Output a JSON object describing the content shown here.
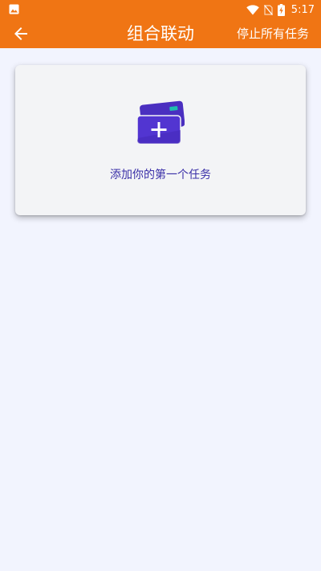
{
  "status_bar": {
    "time": "5:17",
    "icons": [
      "image-icon",
      "wifi-icon",
      "no-sim-icon",
      "battery-charging-icon"
    ]
  },
  "app_bar": {
    "title": "组合联动",
    "back_icon": "arrow-left-icon",
    "action_label": "停止所有任务"
  },
  "empty_state": {
    "icon": "add-task-cards-icon",
    "message": "添加你的第一个任务"
  },
  "colors": {
    "header": "#f07514",
    "background": "#f2f4fe",
    "card": "#f3f4f6",
    "accent": "#3a2fa8",
    "icon_purple": "#4a2fc0",
    "icon_teal": "#1fbfae"
  }
}
